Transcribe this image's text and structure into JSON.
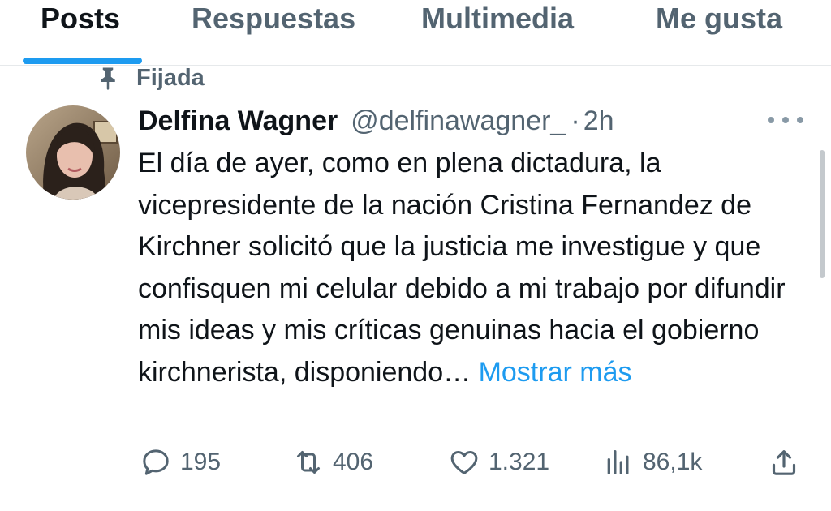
{
  "tabs": [
    {
      "label": "Posts",
      "active": true
    },
    {
      "label": "Respuestas"
    },
    {
      "label": "Multimedia"
    },
    {
      "label": "Me gusta"
    }
  ],
  "pinned_label": "Fijada",
  "tweet": {
    "display_name": "Delfina Wagner",
    "handle": "@delfinawagner_",
    "separator": "·",
    "time": "2h",
    "text": "El día de ayer, como en plena dictadura, la vicepresidente de la nación Cristina Fernandez de Kirchner solicitó que la justicia me investigue y que confisquen mi celular debido a mi trabajo por difundir mis ideas y mis críticas genuinas hacia el gobierno kirchnerista, disponiendo…",
    "show_more": "Mostrar más"
  },
  "actions": {
    "replies": "195",
    "reposts": "406",
    "likes": "1.321",
    "views": "86,1k"
  },
  "colors": {
    "accent": "#1d9bf0",
    "text_primary": "#0f1419",
    "text_secondary": "#536471",
    "divider": "#e6e9eb"
  },
  "icons": [
    "pin-icon",
    "more-icon",
    "reply-icon",
    "repost-icon",
    "like-icon",
    "views-icon",
    "share-icon"
  ]
}
